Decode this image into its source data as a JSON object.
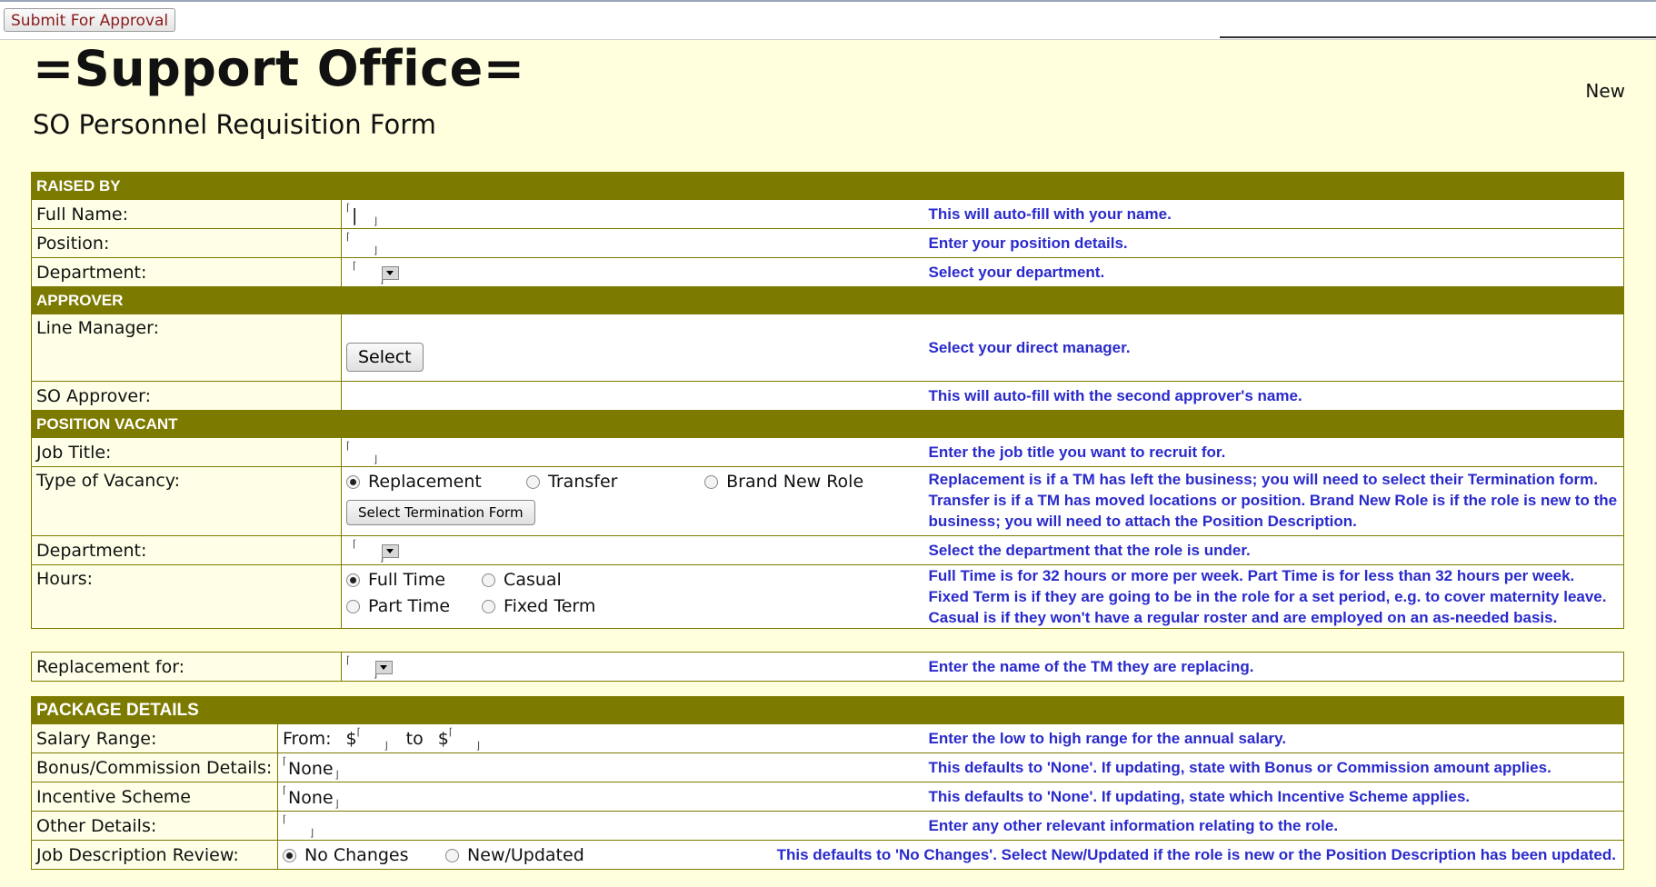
{
  "toolbar": {
    "submit_label": "Submit For Approval"
  },
  "header": {
    "title": "=Support Office=",
    "subtitle": "SO Personnel Requisition Form",
    "status": "New"
  },
  "raised_by": {
    "section": "RAISED BY",
    "full_name_label": "Full Name:",
    "full_name_help": "This will auto-fill with your name.",
    "position_label": "Position:",
    "position_help": "Enter your position details.",
    "department_label": "Department:",
    "department_help": "Select your department."
  },
  "approver": {
    "section": "APPROVER",
    "line_manager_label": "Line Manager:",
    "select_button": "Select",
    "line_manager_help": "Select your direct manager.",
    "so_approver_label": "SO Approver:",
    "so_approver_help": "This will auto-fill with the second approver's name."
  },
  "position_vacant": {
    "section": "POSITION VACANT",
    "job_title_label": "Job Title:",
    "job_title_help": "Enter the job title you want to recruit for.",
    "vacancy_label": "Type of Vacancy:",
    "vacancy_options": [
      "Replacement",
      "Transfer",
      "Brand New Role"
    ],
    "vacancy_selected": "Replacement",
    "termination_button": "Select Termination Form",
    "vacancy_help": "Replacement is if a TM has left the business; you will need to select their Termination form. Transfer is if a TM has moved locations or position. Brand New Role is if the role is new to the business; you will need to attach the Position Description.",
    "department_label": "Department:",
    "department_help": "Select the department that the role is under.",
    "hours_label": "Hours:",
    "hours_options": [
      "Full Time",
      "Casual",
      "Part Time",
      "Fixed Term"
    ],
    "hours_selected": "Full Time",
    "hours_help": "Full Time is for 32 hours or more per week. Part Time is for less than 32 hours per week. Fixed Term is if they are going to be in the role for a set period, e.g. to cover maternity leave. Casual is if they won't have a regular roster and are employed on an as-needed basis."
  },
  "replacement": {
    "label": "Replacement for:",
    "help": "Enter the name of the TM they are replacing."
  },
  "package": {
    "section": "PACKAGE DETAILS",
    "salary_label": "Salary Range:",
    "from_label": "From:",
    "to_label": "to",
    "currency": "$",
    "salary_help": "Enter the low to high range for the annual salary.",
    "bonus_label": "Bonus/Commission Details:",
    "bonus_value": "None",
    "bonus_help": "This defaults to 'None'. If updating, state with Bonus or Commission amount applies.",
    "incentive_label": "Incentive Scheme",
    "incentive_value": "None",
    "incentive_help": "This defaults to 'None'. If updating, state which Incentive Scheme applies.",
    "other_label": "Other Details:",
    "other_help": "Enter any other relevant information relating to the role.",
    "jd_label": "Job Description Review:",
    "jd_options": [
      "No Changes",
      "New/Updated"
    ],
    "jd_selected": "No Changes",
    "jd_help": "This defaults to 'No Changes'. Select New/Updated if the role is new or the Position Description has been updated."
  },
  "colors": {
    "section_bg": "#7d7a00",
    "page_bg": "#ffffdd",
    "help_text": "#2a2acc",
    "button_text": "#8b1a1a"
  }
}
